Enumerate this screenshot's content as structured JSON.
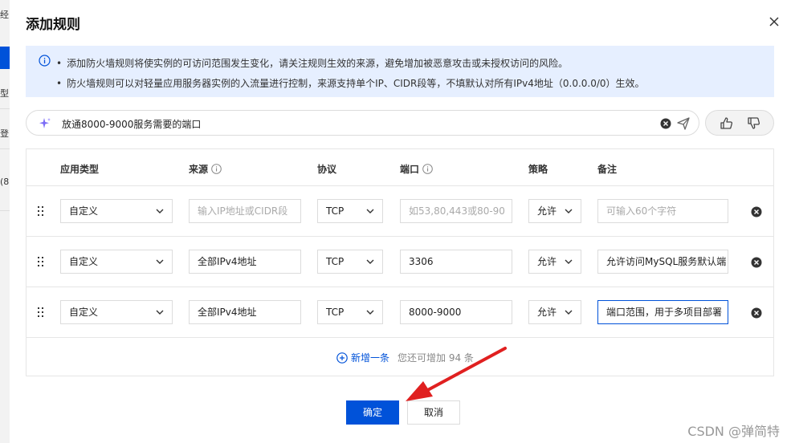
{
  "backdrop": {
    "fragments": [
      "经",
      "型",
      "登",
      "(8"
    ]
  },
  "dialog": {
    "title": "添加规则",
    "notice": [
      "添加防火墙规则将使实例的可访问范围发生变化，请关注规则生效的来源，避免增加被恶意攻击或未授权访问的风险。",
      "防火墙规则可以对轻量应用服务器实例的入流量进行控制，来源支持单个IP、CIDR段等，不填默认对所有IPv4地址（0.0.0.0/0）生效。"
    ],
    "ai_input": {
      "value": "放通8000-9000服务需要的端口"
    },
    "headers": {
      "app_type": "应用类型",
      "source": "来源",
      "protocol": "协议",
      "port": "端口",
      "policy": "策略",
      "remark": "备注"
    },
    "rows": [
      {
        "app_type": "自定义",
        "source": "",
        "source_placeholder": "输入IP地址或CIDR段",
        "protocol": "TCP",
        "port": "",
        "port_placeholder": "如53,80,443或80-90",
        "policy": "允许",
        "remark": "",
        "remark_placeholder": "可输入60个字符"
      },
      {
        "app_type": "自定义",
        "source": "全部IPv4地址",
        "protocol": "TCP",
        "port": "3306",
        "policy": "允许",
        "remark": "允许访问MySQL服务默认端"
      },
      {
        "app_type": "自定义",
        "source": "全部IPv4地址",
        "protocol": "TCP",
        "port": "8000-9000",
        "policy": "允许",
        "remark": "端口范围，用于多项目部署"
      }
    ],
    "add_label": "新增一条",
    "remain_text": "您还可增加 94 条",
    "ok_label": "确定",
    "cancel_label": "取消"
  },
  "watermark": "CSDN @弹简特",
  "colors": {
    "primary": "#0052d9",
    "notice_bg": "#e6efff",
    "arrow": "#e02020"
  }
}
